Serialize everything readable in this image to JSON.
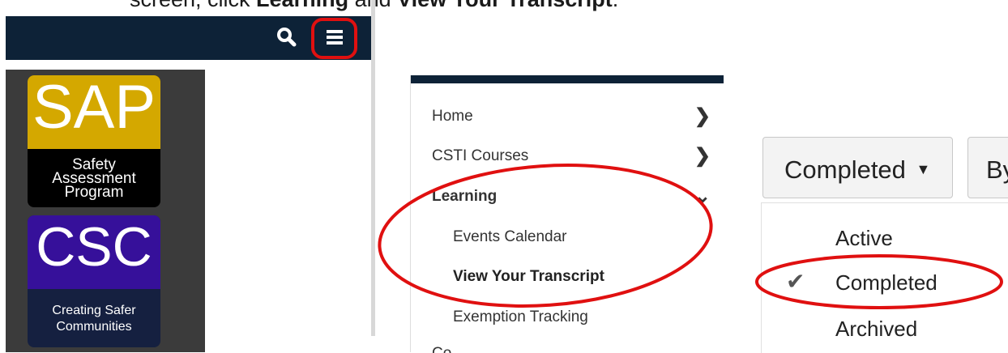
{
  "instruction": {
    "pre": "screen, click ",
    "bold1": "Learning",
    "mid": " and ",
    "bold2": "View Your Transcript",
    "post": "."
  },
  "navbar": {
    "search_icon": "search-icon",
    "menu_icon": "hamburger-menu-icon"
  },
  "tiles": {
    "sap": {
      "abbr": "SAP",
      "line1": "Safety",
      "line2": "Assessment",
      "line3": "Program"
    },
    "csc": {
      "abbr": "CSC",
      "line1": "Creating Safer",
      "line2": "Communities"
    }
  },
  "menu": {
    "home": "Home",
    "csti": "CSTI Courses",
    "learning": "Learning",
    "events": "Events Calendar",
    "transcript": "View Your Transcript",
    "exemption": "Exemption Tracking",
    "cut_item": "Co..."
  },
  "filter": {
    "selected": "Completed",
    "by_label": "By",
    "options": [
      "Active",
      "Completed",
      "Archived"
    ],
    "checked_index": 1
  },
  "colors": {
    "navbar": "#0d2237",
    "highlight_ring": "#e01010",
    "sap_gold": "#d4a800",
    "csc_purple": "#36109a"
  }
}
